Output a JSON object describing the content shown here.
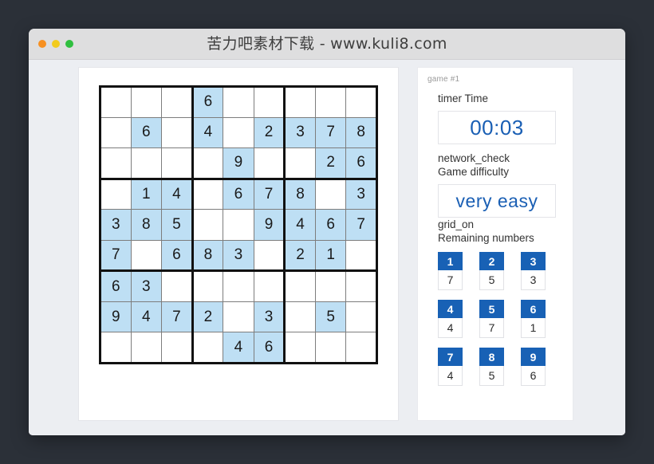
{
  "window": {
    "title": "苦力吧素材下载 - www.kuli8.com",
    "traffic_lights": [
      "close-dot",
      "minimize-dot",
      "zoom-dot"
    ]
  },
  "sidebar": {
    "game_label": "game #1",
    "timer": {
      "icon_name": "timer",
      "label": "timer Time",
      "value": "00:03"
    },
    "difficulty": {
      "icon_name": "network_check",
      "label_icon": "network_check",
      "label": "Game difficulty",
      "value": "very easy"
    },
    "remaining": {
      "label_icon": "grid_on",
      "label": "Remaining numbers",
      "items": [
        {
          "number": "1",
          "count": "7"
        },
        {
          "number": "2",
          "count": "5"
        },
        {
          "number": "3",
          "count": "3"
        },
        {
          "number": "4",
          "count": "4"
        },
        {
          "number": "5",
          "count": "7"
        },
        {
          "number": "6",
          "count": "1"
        },
        {
          "number": "7",
          "count": "4"
        },
        {
          "number": "8",
          "count": "5"
        },
        {
          "number": "9",
          "count": "6"
        }
      ]
    }
  },
  "board": {
    "rows": [
      [
        "",
        "",
        "",
        "6",
        "",
        "",
        "",
        "",
        ""
      ],
      [
        "",
        "6",
        "",
        "4",
        "",
        "2",
        "3",
        "7",
        "8"
      ],
      [
        "",
        "",
        "",
        "",
        "9",
        "",
        "",
        "2",
        "6"
      ],
      [
        "",
        "1",
        "4",
        "",
        "6",
        "7",
        "8",
        "",
        "3"
      ],
      [
        "3",
        "8",
        "5",
        "",
        "",
        "9",
        "4",
        "6",
        "7"
      ],
      [
        "7",
        "",
        "6",
        "8",
        "3",
        "",
        "2",
        "1",
        ""
      ],
      [
        "6",
        "3",
        "",
        "",
        "",
        "",
        "",
        "",
        ""
      ],
      [
        "9",
        "4",
        "7",
        "2",
        "",
        "3",
        "",
        "5",
        ""
      ],
      [
        "",
        "",
        "",
        "",
        "4",
        "6",
        "",
        "",
        ""
      ]
    ]
  },
  "colors": {
    "accent_blue": "#1861b5",
    "value_blue": "#1a5fb4",
    "cell_fill": "#bedff4",
    "grid_line": "#7d7d7d",
    "grid_bold": "#111111",
    "window_bg": "#eceef2",
    "titlebar_bg": "#dededf",
    "page_bg": "#2b3038"
  }
}
